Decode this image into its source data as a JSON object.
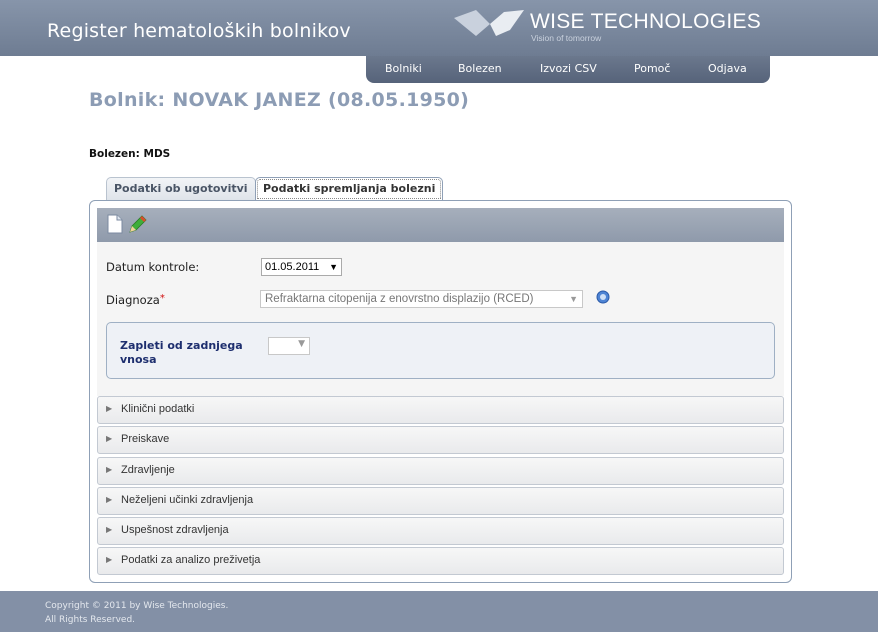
{
  "header": {
    "app_title": "Register hematoloških bolnikov",
    "logo_name": "WISE TECHNOLOGIES",
    "logo_tagline": "Vision of tomorrow",
    "nav": [
      "Bolniki",
      "Bolezen",
      "Izvozi CSV",
      "Pomoč",
      "Odjava"
    ]
  },
  "patient": {
    "title": "Bolnik: NOVAK JANEZ (08.05.1950)",
    "disease": "Bolezen: MDS"
  },
  "tabs": [
    "Podatki ob ugotovitvi",
    "Podatki spremljanja bolezni"
  ],
  "form": {
    "date_label": "Datum kontrole:",
    "date_value": "01.05.2011",
    "diagnosis_label": "Diagnoza",
    "diagnosis_required": "*",
    "diagnosis_value": "Refraktarna citopenija z enovrstno displazijo (RCED)",
    "complications_label": "Zapleti od zadnjega vnosa",
    "complications_value": ""
  },
  "sections": [
    "Klinični podatki",
    "Preiskave",
    "Zdravljenje",
    "Neželjeni učinki zdravljenja",
    "Uspešnost zdravljenja",
    "Podatki za analizo preživetja"
  ],
  "footer": {
    "line1": "Copyright © 2011 by Wise Technologies.",
    "line2": "All Rights Reserved."
  },
  "colors": {
    "header": "#7b889e",
    "title": "#8c9cb4",
    "accent_border": "#8fa0b6"
  }
}
